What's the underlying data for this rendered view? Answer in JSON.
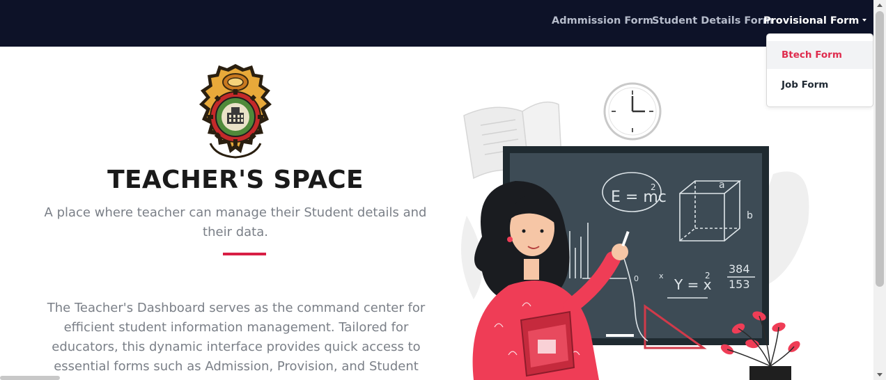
{
  "navbar": {
    "items": [
      {
        "label": "Admmission Form"
      },
      {
        "label": "Student Details Form"
      },
      {
        "label": "Provisional Form"
      }
    ]
  },
  "dropdown": {
    "items": [
      {
        "label": "Btech Form"
      },
      {
        "label": "Job Form"
      }
    ]
  },
  "hero": {
    "title": "TEACHER'S SPACE",
    "subtitle": "A place where teacher can manage their Student details and their data.",
    "description": "The Teacher's Dashboard serves as the command center for efficient student information management. Tailored for educators, this dynamic interface provides quick access to essential forms such as Admission, Provision, and Student Details. With a user-friendly"
  },
  "illustration": {
    "formula_1": "E = mc",
    "formula_1_exp": "2",
    "formula_2": "Y = x",
    "formula_2_exp": "2",
    "fraction_top": "384",
    "fraction_bottom": "153",
    "cube_label_a": "a",
    "cube_label_b": "b",
    "graph_label_x": "x",
    "graph_label_0": "0"
  },
  "colors": {
    "navbar_bg": "#0d1228",
    "accent": "#d81e44",
    "board": "#3d4b55",
    "dress": "#ef3d56",
    "hair": "#1a1c20"
  }
}
